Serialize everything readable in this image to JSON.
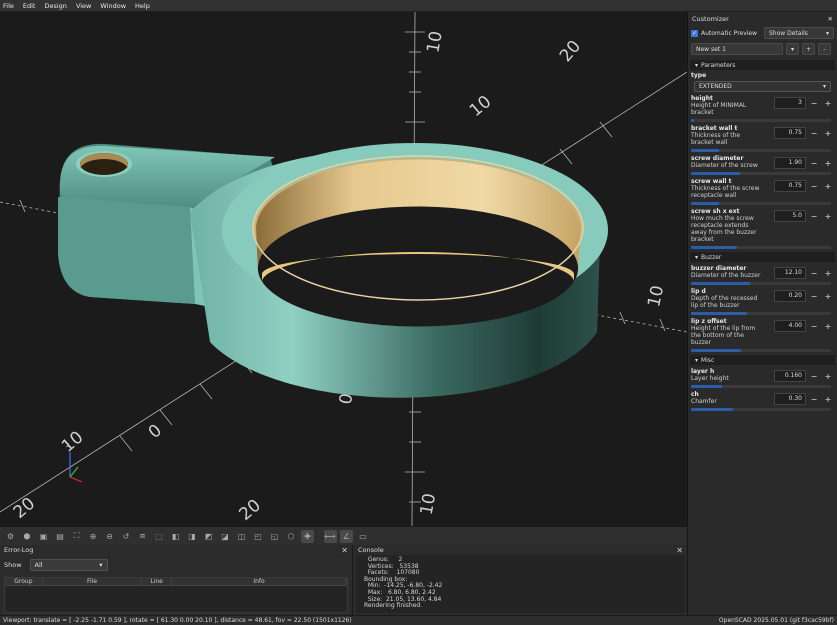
{
  "menu": [
    "File",
    "Edit",
    "Design",
    "View",
    "Window",
    "Help"
  ],
  "viewport": {
    "axis_labels": [
      "10",
      "20",
      "10",
      "10",
      "20",
      "10",
      "10",
      "20",
      "0",
      "0"
    ],
    "gizmo": {
      "z": "z"
    }
  },
  "error_log": {
    "title": "Error-Log",
    "show_label": "Show",
    "show_value": "All",
    "columns": [
      "Group",
      "File",
      "Line",
      "Info"
    ]
  },
  "console": {
    "title": "Console",
    "lines": [
      "  Genus:     2",
      "  Vertices:   53538",
      "  Facets:    107080",
      "Bounding box:",
      "  Min:  -14.25, -6.80, -2.42",
      "  Max:   6.80, 6.80, 2.42",
      "  Size:  21.05, 13.60, 4.84",
      "Rendering finished."
    ]
  },
  "status": {
    "left": "Viewport: translate = [ -2.25 -1.71 0.59 ], rotate = [ 61.30 0.00 20.10 ], distance = 48.61, fov = 22.50 (1501x1126)",
    "right": "OpenSCAD 2025.05.01 (git f3cac59bf)"
  },
  "customizer": {
    "title": "Customizer",
    "auto_preview": "Automatic Preview",
    "show_details": "Show Details",
    "preset": "New set 1",
    "sections": {
      "parameters": "Parameters",
      "buzzer": "Buzzer",
      "misc": "Misc"
    },
    "type": {
      "name": "type",
      "value": "EXTENDED"
    },
    "params_main": [
      {
        "name": "height",
        "desc": "Height of MINIMAL bracket",
        "value": "3",
        "fill": 0.0
      },
      {
        "name": "bracket wall t",
        "desc": "Thickness of the bracket wall",
        "value": "0.75",
        "fill": 0.2
      },
      {
        "name": "screw diameter",
        "desc": "Diameter of the screw",
        "value": "1.90",
        "fill": 0.35
      },
      {
        "name": "screw wall t",
        "desc": "Thickness of the screw receptacle wall",
        "value": "0.75",
        "fill": 0.2
      },
      {
        "name": "screw sh x ext",
        "desc": "How much the screw receptacle extends away from the buzzer bracket",
        "value": "5.0",
        "fill": 0.33
      }
    ],
    "params_buzzer": [
      {
        "name": "buzzer diameter",
        "desc": "Diameter of the buzzer",
        "value": "12.10",
        "fill": 0.42
      },
      {
        "name": "lip d",
        "desc": "Depth of the recessed lip of the buzzer",
        "value": "0.20",
        "fill": 0.4
      },
      {
        "name": "lip z offset",
        "desc": "Height of the lip from the bottom of the buzzer",
        "value": "4.00",
        "fill": 0.36
      }
    ],
    "params_misc": [
      {
        "name": "layer h",
        "desc": "Layer height",
        "value": "0.160",
        "fill": 0.22
      },
      {
        "name": "ch",
        "desc": "Chamfer",
        "value": "0.30",
        "fill": 0.3
      }
    ]
  }
}
